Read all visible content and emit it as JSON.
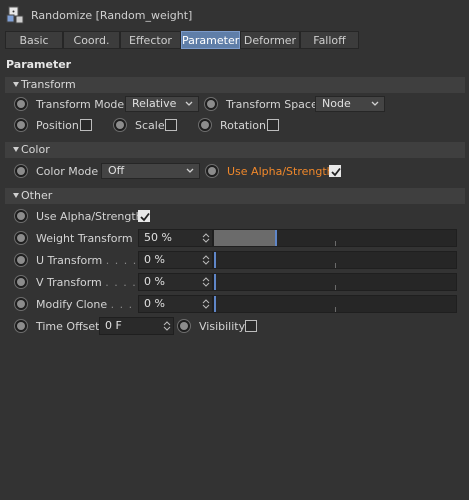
{
  "window": {
    "title": "Randomize [Random_weight]",
    "icon": "randomize-effector-icon"
  },
  "tabs": [
    {
      "label": "Basic",
      "active": false
    },
    {
      "label": "Coord.",
      "active": false
    },
    {
      "label": "Effector",
      "active": false
    },
    {
      "label": "Parameter",
      "active": true
    },
    {
      "label": "Deformer",
      "active": false
    },
    {
      "label": "Falloff",
      "active": false
    }
  ],
  "section": {
    "title": "Parameter"
  },
  "transform": {
    "header": "Transform",
    "mode_label": "Transform Mode",
    "mode_value": "Relative",
    "space_label": "Transform Space",
    "space_value": "Node",
    "position_label": "Position",
    "position_checked": false,
    "scale_label": "Scale",
    "scale_checked": false,
    "rotation_label": "Rotation",
    "rotation_checked": false
  },
  "color": {
    "header": "Color",
    "mode_label": "Color Mode",
    "mode_value": "Off",
    "alpha_label": "Use Alpha/Strength",
    "alpha_checked": true
  },
  "other": {
    "header": "Other",
    "alpha_label": "Use Alpha/Strength",
    "alpha_checked": true,
    "weight_label": "Weight Transform",
    "weight_value": "50 %",
    "weight_fraction": 0.5,
    "u_label": "U Transform",
    "u_dots": ". . . . .",
    "u_value": "0 %",
    "u_fraction": 0,
    "v_label": "V Transform",
    "v_dots": ". . . . .",
    "v_value": "0 %",
    "v_fraction": 0,
    "clone_label": "Modify Clone",
    "clone_dots": ". . . .",
    "clone_value": "0 %",
    "clone_fraction": 0,
    "time_label": "Time Offset",
    "time_value": "0 F",
    "visibility_label": "Visibility",
    "visibility_checked": false
  },
  "colors": {
    "active_tab": "#5f7ea8",
    "orange_label": "#f0882b",
    "slider_handle": "#5f86c8"
  }
}
